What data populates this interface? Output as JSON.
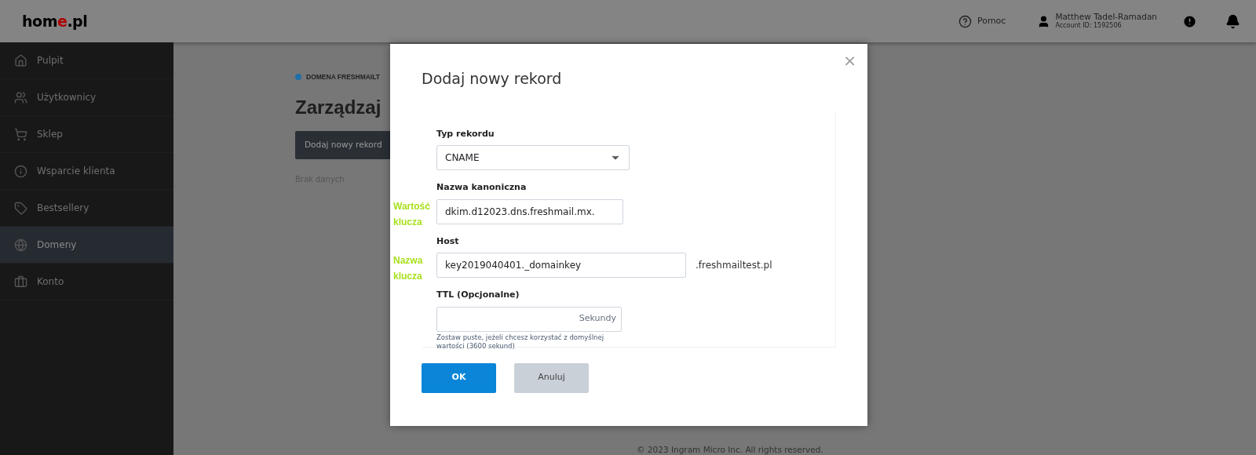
{
  "header": {
    "logo": [
      {
        "text": "hom",
        "accent": false
      },
      {
        "text": "e",
        "accent": true
      },
      {
        "text": ".pl",
        "accent": false
      }
    ],
    "help": "Pomoc",
    "user": {
      "name": "Matthew Tadel-Ramadan",
      "account": "Account ID: 1592506"
    }
  },
  "sidebar": {
    "items": [
      {
        "label": "Pulpit",
        "selected": false
      },
      {
        "label": "Użytkownicy",
        "selected": false
      },
      {
        "label": "Sklep",
        "selected": false
      },
      {
        "label": "Wsparcie klienta",
        "selected": false
      },
      {
        "label": "Bestsellery",
        "selected": false
      },
      {
        "label": "Domeny",
        "selected": true
      },
      {
        "label": "Konto",
        "selected": false
      }
    ]
  },
  "content": {
    "breadcrumb": "DOMENA FRESHMAILT",
    "title": "Zarządzaj",
    "button": "Dodaj nowy rekord",
    "empty": "Brak danych",
    "footer": "© 2023 Ingram Micro Inc. All rights reserved."
  },
  "modal": {
    "title": "Dodaj nowy rekord",
    "close": "×",
    "fields": [
      {
        "kind": "select",
        "label": "Typ rekordu",
        "value": "CNAME"
      },
      {
        "kind": "text",
        "label": "Nazwa kanoniczna",
        "value": "dkim.d12023.dns.freshmail.mx.",
        "annotation": "Wartość klucza"
      },
      {
        "kind": "text",
        "label": "Host",
        "value": "key2019040401._domainkey",
        "suffix": ".freshmailtest.pl",
        "annotation": "Nazwa klucza"
      },
      {
        "kind": "unit",
        "label": "TTL (Opcjonalne)",
        "unit": "Sekundy",
        "help": "Zostaw puste, jeżeli chcesz korzystać z domyślnej wartości (3600 sekund)"
      }
    ],
    "ok": "OK",
    "cancel": "Anuluj"
  }
}
